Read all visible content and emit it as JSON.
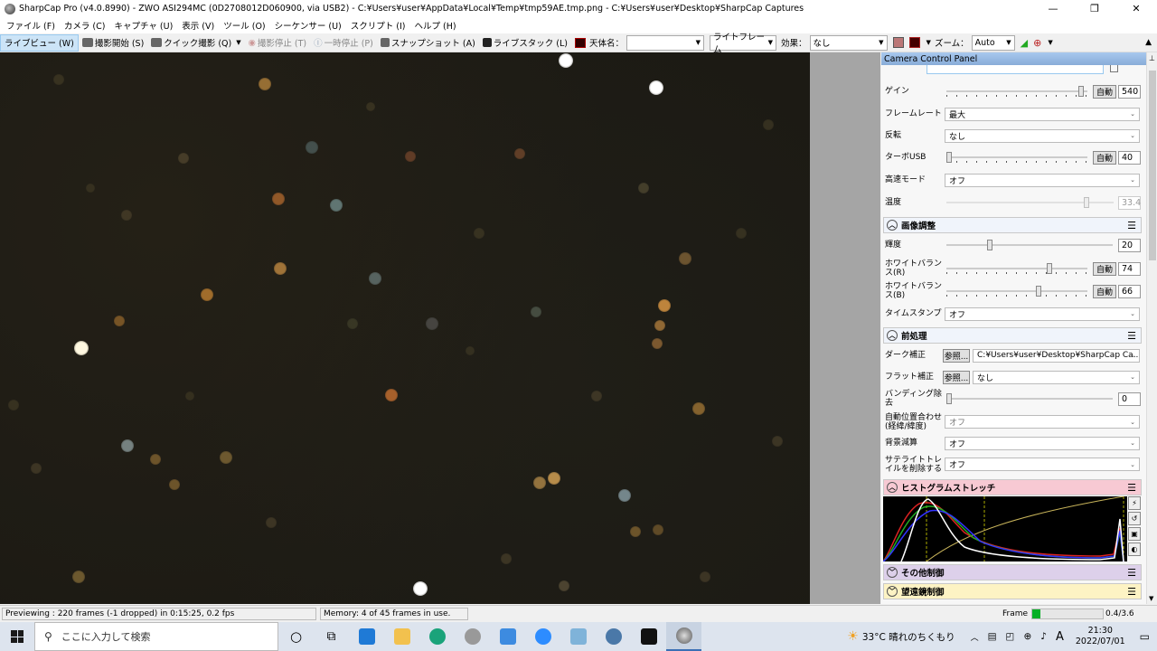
{
  "window": {
    "title": "SharpCap Pro (v4.0.8990) - ZWO ASI294MC (0D2708012D060900, via USB2) - C:¥Users¥user¥AppData¥Local¥Temp¥tmp59AE.tmp.png - C:¥Users¥user¥Desktop¥SharpCap Captures",
    "minimize": "—",
    "maximize": "❐",
    "close": "✕"
  },
  "menu": [
    "ファイル (F)",
    "カメラ (C)",
    "キャプチャ (U)",
    "表示 (V)",
    "ツール (O)",
    "シーケンサー (U)",
    "スクリプト (I)",
    "ヘルプ (H)"
  ],
  "toolbar": {
    "live_view": "ライブビュー (W)",
    "start_capture": "撮影開始 (S)",
    "quick_capture": "クイック撮影 (Q)",
    "stop_capture": "撮影停止 (T)",
    "pause": "一時停止 (P)",
    "snapshot": "スナップショット (A)",
    "live_stack": "ライブスタック (L)",
    "target_label": "天体名：",
    "target_value": "",
    "frame_type": "ライトフレーム",
    "effect_label": "効果：",
    "effect_value": "なし",
    "zoom_label": "ズーム：",
    "zoom_value": "Auto"
  },
  "panel": {
    "title": "Camera Control Panel",
    "gain": {
      "label": "ゲイン",
      "auto": "自動",
      "value": "540",
      "level": 0.97
    },
    "frame_rate": {
      "label": "フレームレート",
      "value": "最大"
    },
    "flip": {
      "label": "反転",
      "value": "なし"
    },
    "turbo_usb": {
      "label": "ターボUSB",
      "auto": "自動",
      "value": "40",
      "level": 0.0
    },
    "high_speed": {
      "label": "高速モード",
      "value": "オフ"
    },
    "temperature": {
      "label": "温度",
      "value": "33.4",
      "level": 0.85
    },
    "image_section": "画像調整",
    "brightness": {
      "label": "輝度",
      "value": "20",
      "level": 0.25
    },
    "wb_r": {
      "label": "ホワイトバランス(R)",
      "auto": "自動",
      "value": "74",
      "level": 0.74
    },
    "wb_b": {
      "label": "ホワイトバランス(B)",
      "auto": "自動",
      "value": "66",
      "level": 0.66
    },
    "timestamp": {
      "label": "タイムスタンプ",
      "value": "オフ"
    },
    "pre_section": "前処理",
    "dark": {
      "label": "ダーク補正",
      "browse": "参照...",
      "value": "C:¥Users¥user¥Desktop¥SharpCap Ca..."
    },
    "flat": {
      "label": "フラット補正",
      "browse": "参照...",
      "value": "なし"
    },
    "banding": {
      "label": "バンディング除去",
      "value": "0",
      "level": 0.0
    },
    "auto_align": {
      "label": "自動位置合わせ(経緯/緯度)",
      "value": "オフ"
    },
    "bg_subtract": {
      "label": "背景減算",
      "value": "オフ"
    },
    "sat_trail": {
      "label": "サテライトトレイルを削除する",
      "value": "オフ"
    },
    "histo_section": "ヒストグラムストレッチ",
    "misc_section": "その他制御",
    "scope_section": "望遠鏡制御"
  },
  "status": {
    "preview": "Previewing : 220 frames (-1 dropped) in 0:15:25, 0.2 fps",
    "memory": "Memory: 4 of 45 frames in use.",
    "frame_label": "Frame :",
    "frame_value": "0.4/3.6",
    "frame_progress": 0.11
  },
  "taskbar": {
    "search_placeholder": "ここに入力して検索",
    "weather": "33°C 晴れのちくもり",
    "ime": "A",
    "time": "21:30",
    "date": "2022/07/01"
  },
  "colors": {
    "sky": "#1c1a14",
    "accent_blue": "#cce4f7",
    "histo_header": "#f7c9d3",
    "misc_header": "#ddd0ea",
    "scope_header": "#fdf3c4",
    "image_header": "#f0f4fb"
  }
}
